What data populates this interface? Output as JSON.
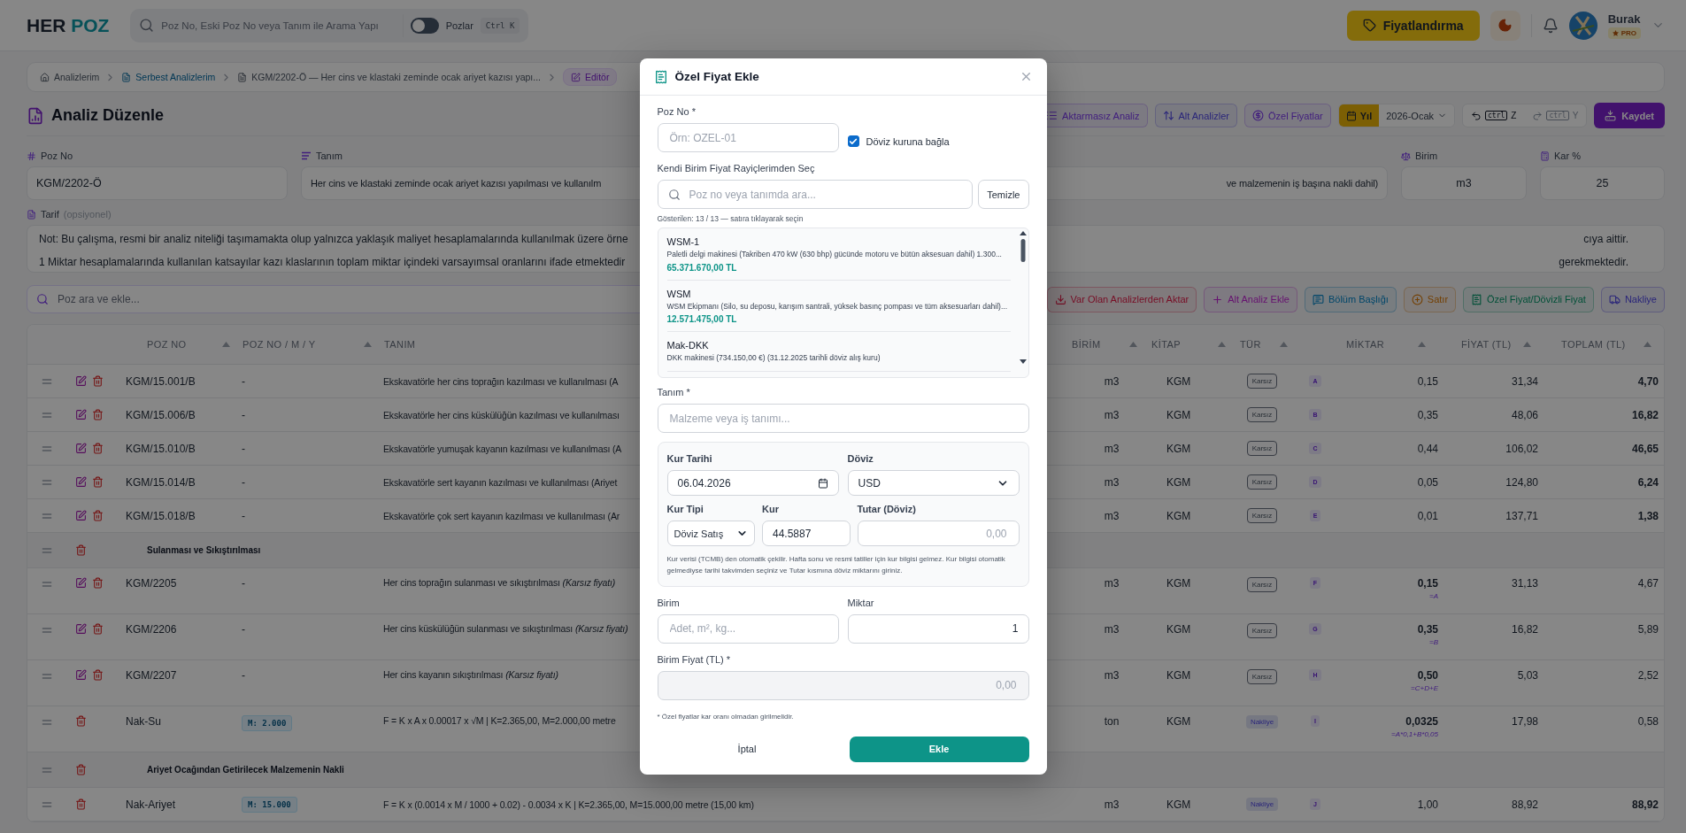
{
  "header": {
    "logo_first": "HER",
    "logo_second": "POZ",
    "search_placeholder": "Poz No, Eski Poz No veya Tanım ile Arama Yapı",
    "toggle": {
      "label": "Pozlar",
      "on": false
    },
    "shortcut": "Ctrl K",
    "pricing_button": "Fiyatlandırma",
    "user": {
      "name": "Burak",
      "badge": "PRO"
    }
  },
  "breadcrumbs": [
    {
      "label": "Analizlerim",
      "kind": "plain",
      "selected": false
    },
    {
      "label": "Serbest Analizlerim",
      "kind": "link",
      "selected": false
    },
    {
      "label": "KGM/2202-Ö — Her cins ve klastaki zeminde ocak ariyet kazısı yapı...",
      "kind": "plain",
      "selected": false
    },
    {
      "label": "Editör",
      "kind": "current",
      "selected": true
    }
  ],
  "page_title": "Analiz Düzenle",
  "toolbar": {
    "buttons": [
      {
        "label": "Aktarmasız Analiz",
        "kind": "analysis"
      },
      {
        "label": "Alt Analizler",
        "kind": "subanalysis"
      },
      {
        "label": "Özel Fiyatlar",
        "kind": "prices"
      }
    ],
    "year_label": "Yıl",
    "period": "2026-Ocak",
    "undo": {
      "key": "ctrl",
      "letter": "Z",
      "disabled": false
    },
    "redo": {
      "key": "ctrl",
      "letter": "Y",
      "disabled": true
    },
    "save": "Kaydet"
  },
  "fields": {
    "poz_no": {
      "label": "Poz No",
      "value": "KGM/2202-Ö"
    },
    "tanim": {
      "label": "Tanım",
      "value_start": "Her cins ve klastaki zeminde ocak ariyet kazısı yapılması ve kullanılm",
      "value_end": "ve malzemenin iş başına nakli dahil)"
    },
    "birim": {
      "label": "Birim",
      "value": "m3"
    },
    "kar": {
      "label": "Kar %",
      "value": "25"
    }
  },
  "tarif": {
    "label": "Tarif",
    "hint": "(opsiyonel)",
    "lines": [
      {
        "start": "Not: Bu çalışma, resmi bir analiz niteliği taşımamakta olup yalnızca yaklaşık maliyet hesaplamalarında kullanılmak üzere örne",
        "end": "cıya aittir."
      },
      {
        "start": "1 Miktar hesaplamalarında kullanılan katsayılar kazı klaslarının toplam miktar içindeki varsayımsal oranlarını ifade etmektedir",
        "end": "gerekmektedir."
      }
    ]
  },
  "add_bar": {
    "placeholder": "Poz ara ve ekle...",
    "actions": [
      {
        "label": "Var Olan Analizlerden Aktar",
        "kind": "import"
      },
      {
        "label": "Alt Analiz Ekle",
        "kind": "subanalysis"
      },
      {
        "label": "Bölüm Başlığı",
        "kind": "heading"
      },
      {
        "label": "Satır",
        "kind": "row"
      },
      {
        "label": "Özel Fiyat/Dövizli Fiyat",
        "kind": "special"
      },
      {
        "label": "Nakliye",
        "kind": "transport"
      }
    ]
  },
  "table": {
    "columns": [
      {
        "label": "POZ NO",
        "sortable": true
      },
      {
        "label": "POZ NO / M / Y",
        "sortable": true
      },
      {
        "label": "TANIM",
        "sortable": false
      },
      {
        "label": "BİRİM",
        "sortable": true
      },
      {
        "label": "KİTAP",
        "sortable": true
      },
      {
        "label": "TÜR",
        "sortable": true
      },
      {
        "label": "MİKTAR",
        "sortable": true
      },
      {
        "label": "FİYAT (TL)",
        "sortable": true
      },
      {
        "label": "TOPLAM (TL)",
        "sortable": true
      }
    ],
    "rows": [
      {
        "kind": "item",
        "editable": true,
        "poz": "KGM/15.001/B",
        "pozmy": {
          "text": "-",
          "kind": "plain"
        },
        "tanim": "Ekskavatörle her cins toprağın kazılması ve kullanılması (A",
        "birim": "m3",
        "kitap": "KGM",
        "tur": {
          "label": "Karsız",
          "kind": "outline"
        },
        "letter": "A",
        "miktar": "0,15",
        "fiyat": "31,34",
        "toplam": "4,70",
        "highlight": true
      },
      {
        "kind": "item",
        "editable": true,
        "poz": "KGM/15.006/B",
        "pozmy": {
          "text": "-",
          "kind": "plain"
        },
        "tanim": "Ekskavatörle her cins küskülüğün kazılması ve kullanılması",
        "birim": "m3",
        "kitap": "KGM",
        "tur": {
          "label": "Karsız",
          "kind": "outline"
        },
        "letter": "B",
        "miktar": "0,35",
        "fiyat": "48,06",
        "toplam": "16,82",
        "highlight": true
      },
      {
        "kind": "item",
        "editable": true,
        "poz": "KGM/15.010/B",
        "pozmy": {
          "text": "-",
          "kind": "plain"
        },
        "tanim": "Ekskavatörle yumuşak kayanın kazılması ve kullanılması (A",
        "birim": "m3",
        "kitap": "KGM",
        "tur": {
          "label": "Karsız",
          "kind": "outline"
        },
        "letter": "C",
        "miktar": "0,44",
        "fiyat": "106,02",
        "toplam": "46,65",
        "highlight": true
      },
      {
        "kind": "item",
        "editable": true,
        "poz": "KGM/15.014/B",
        "pozmy": {
          "text": "-",
          "kind": "plain"
        },
        "tanim": "Ekskavatörle sert kayanın kazılması ve kullanılması (Ariyet",
        "birim": "m3",
        "kitap": "KGM",
        "tur": {
          "label": "Karsız",
          "kind": "outline"
        },
        "letter": "D",
        "miktar": "0,05",
        "fiyat": "124,80",
        "toplam": "6,24",
        "highlight": true
      },
      {
        "kind": "item",
        "editable": true,
        "poz": "KGM/15.018/B",
        "pozmy": {
          "text": "-",
          "kind": "plain"
        },
        "tanim": "Ekskavatörle çok sert kayanın kazılması ve kullanılması (Ar",
        "birim": "m3",
        "kitap": "KGM",
        "tur": {
          "label": "Karsız",
          "kind": "outline"
        },
        "letter": "E",
        "miktar": "0,01",
        "fiyat": "137,71",
        "toplam": "1,38",
        "highlight": true
      },
      {
        "kind": "section",
        "title": "Sulanması ve Sıkıştırılması"
      },
      {
        "kind": "item",
        "editable": true,
        "poz": "KGM/2205",
        "pozmy": {
          "text": "-",
          "kind": "plain"
        },
        "tanim": "Her cins toprağın sulanması ve sıkıştırılması *(Karsız fiyatı)*",
        "birim": "m3",
        "kitap": "KGM",
        "tur": {
          "label": "Karsız",
          "kind": "outline"
        },
        "letter": "F",
        "miktar": "0,15",
        "formula": "=A",
        "fiyat": "31,13",
        "toplam": "4,67",
        "highlight": false
      },
      {
        "kind": "item",
        "editable": true,
        "poz": "KGM/2206",
        "pozmy": {
          "text": "-",
          "kind": "plain"
        },
        "tanim": "Her cins küskülüğün sulanması ve sıkıştırılması *(Karsız fiyatı)*",
        "birim": "m3",
        "kitap": "KGM",
        "tur": {
          "label": "Karsız",
          "kind": "outline"
        },
        "letter": "G",
        "miktar": "0,35",
        "formula": "=B",
        "fiyat": "16,82",
        "toplam": "5,89",
        "highlight": false
      },
      {
        "kind": "item",
        "editable": true,
        "poz": "KGM/2207",
        "pozmy": {
          "text": "-",
          "kind": "plain"
        },
        "tanim": "Her cins kayanın sıkıştırılması *(Karsız fiyatı)*",
        "birim": "m3",
        "kitap": "KGM",
        "tur": {
          "label": "Karsız",
          "kind": "outline"
        },
        "letter": "H",
        "miktar": "0,50",
        "formula": "=C+D+E",
        "fiyat": "5,03",
        "toplam": "2,52",
        "highlight": false
      },
      {
        "kind": "item",
        "editable": false,
        "poz": "Nak-Su",
        "pozmy": {
          "text": "M: 2.000",
          "kind": "tag"
        },
        "tanim": "F = K x A x 0.00017 x √M | K=2.365,00, M=2.000,00 metre",
        "birim": "ton",
        "kitap": "KGM",
        "tur": {
          "label": "Nakliye",
          "kind": "filled"
        },
        "letter": "I",
        "miktar": "0,0325",
        "formula": "=A*0,1+B*0,05",
        "fiyat": "17,98",
        "toplam": "0,58",
        "highlight": false
      },
      {
        "kind": "section",
        "title": "Ariyet Ocağından Getirilecek Malzemenin Nakli"
      },
      {
        "kind": "item",
        "editable": false,
        "poz": "Nak-Ariyet",
        "pozmy": {
          "text": "M: 15.000",
          "kind": "tag"
        },
        "tanim": "F = K x (0.0014 x M / 1000 + 0.02) - 0.0034 x K | K=2.365,00, M=15.000,00 metre (15,00 km)",
        "birim": "m3",
        "kitap": "KGM",
        "tur": {
          "label": "Nakliye",
          "kind": "filled"
        },
        "letter": "J",
        "miktar": "1,00",
        "fiyat": "88,92",
        "toplam": "88,92",
        "highlight": true
      }
    ]
  },
  "modal": {
    "title": "Özel Fiyat Ekle",
    "poz_no": {
      "label": "Poz No *",
      "placeholder": "Örn: OZEL-01"
    },
    "currency_link": {
      "label": "Döviz kuruna bağla",
      "checked": true
    },
    "picker": {
      "label": "Kendi Birim Fiyat Rayiçlerimden Seç",
      "placeholder": "Poz no veya tanımda ara...",
      "clear": "Temizle",
      "count": "Gösterilen: 13 / 13 — satıra tıklayarak seçin",
      "items": [
        {
          "code": "WSM-1",
          "desc": "Paletli delgi makinesi (Takriben 470 kW (630 bhp) gücünde motoru ve bütün aksesuarı dahil) 1.300...",
          "price": "65.371.670,00 TL"
        },
        {
          "code": "WSM",
          "desc": "WSM Ekipmanı (Silo, su deposu, karışım santrali, yüksek basınç pompası ve tüm aksesuarları dahil)...",
          "price": "12.571.475,00 TL"
        },
        {
          "code": "Mak-DKK",
          "desc": "DKK makinesi (734.150,00 €) (31.12.2025 tarihli döviz alış kuru)"
        }
      ]
    },
    "tanim": {
      "label": "Tanım *",
      "placeholder": "Malzeme veya iş tanımı..."
    },
    "rate": {
      "date_label": "Kur Tarihi",
      "date": "06.04.2026",
      "currency_label": "Döviz",
      "currency": "USD",
      "type_label": "Kur Tipi",
      "type": "Döviz Satış",
      "rate_label": "Kur",
      "rate": "44.5887",
      "amount_label": "Tutar (Döviz)",
      "amount_placeholder": "0,00",
      "note": "Kur verisi (TCMB) den otomatik çekilir. Hafta sonu ve resmi tatiller için kur bilgisi gelmez. Kur bilgisi otomatik gelmediyse tarihi takvimden seçiniz ve Tutar kısmına döviz miktarını giriniz."
    },
    "unit": {
      "label": "Birim",
      "placeholder": "Adet, m², kg..."
    },
    "qty": {
      "label": "Miktar",
      "value": "1"
    },
    "unit_price": {
      "label": "Birim Fiyat (TL) *",
      "placeholder": "0,00"
    },
    "footnote": "* Özel fiyatlar kar oranı olmadan girilmelidir.",
    "cancel": "İptal",
    "submit": "Ekle"
  }
}
